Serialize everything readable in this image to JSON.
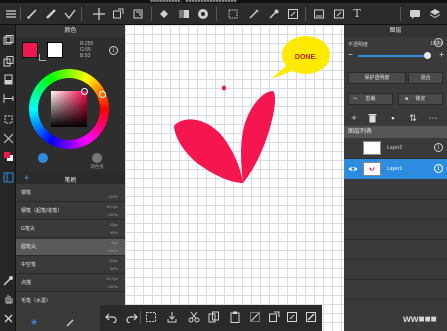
{
  "top_notice": "■■■■■■■■■■，■■■■■■■■■■■■■■■■■",
  "toolbar": {
    "icons": [
      "menu-icon",
      "brush-tool-icon",
      "eraser-icon",
      "checkmark-icon",
      "move-icon",
      "transform-icon",
      "lasso-select-icon",
      "fill-bucket-icon",
      "gradient-icon",
      "color-wheel-icon",
      "rectangle-select-icon",
      "magic-wand-icon",
      "eyedropper-icon",
      "copy-area-icon",
      "filter-icon",
      "select-pen-icon",
      "text-icon",
      "chat-icon",
      "layers-icon"
    ]
  },
  "leftbar": {
    "icons": [
      "layers-toggle-icon",
      "copy-icon",
      "eraser-side-icon",
      "ruler-icon",
      "snap-icon",
      "crop-icon",
      "color-swatch-icon",
      "panel-icon",
      "eyedropper-side-icon",
      "hand-icon",
      "clear-icon"
    ]
  },
  "color_panel": {
    "title": "颜色",
    "main_color": "#f0164f",
    "sub_color": "#ffffff",
    "rgb": {
      "r": "R:255",
      "g": "G:55",
      "b": "B:93"
    },
    "tabs": [
      {
        "label": "",
        "color": "#2d8be0"
      },
      {
        "label": "调色盘",
        "color": "#777777"
      }
    ]
  },
  "brush_panel": {
    "title": "笔刷",
    "items": [
      {
        "name": "钢笔",
        "v1": "",
        "v2": "100%"
      },
      {
        "name": "钢笔（起笔/收笔）",
        "v1": "10.0px",
        "v2": "100%"
      },
      {
        "name": "G笔尖",
        "v1": "15px",
        "v2": "98%"
      },
      {
        "name": "圆笔尖",
        "v1": "8px",
        "v2": "100%"
      },
      {
        "name": "中空笔",
        "v1": "42px",
        "v2": "96%"
      },
      {
        "name": "点描",
        "v1": "10.7px",
        "v2": "100%"
      },
      {
        "name": "毛笔（水墨）",
        "v1": "",
        "v2": ""
      }
    ],
    "selected_index": 3
  },
  "canvas": {
    "bubble_text": "DONE.",
    "bubble_color": "#ffea00",
    "bubble_text_color": "#b3281d",
    "heart_color": "#f5164f"
  },
  "bottom_bar": {
    "icons": [
      "undo-icon",
      "redo-icon",
      "select-all-icon",
      "import-icon",
      "cut-icon",
      "copy-icon",
      "paste-icon",
      "clear-selection-icon",
      "transform-icon",
      "edit-icon",
      "export-icon",
      "fill-icon"
    ]
  },
  "layer_panel": {
    "title": "图层",
    "opacity_label": "不透明度",
    "opacity_value": "100%",
    "opacity_fraction": 1.0,
    "protect_label": "保护透明度",
    "blend_label": "混合",
    "clip_label": "剪裁",
    "lock_label": "锁定",
    "list_title": "图层列表",
    "layers": [
      {
        "name": "Layer2",
        "selected": false,
        "visible": false
      },
      {
        "name": "Layer1",
        "selected": true,
        "visible": true
      }
    ]
  },
  "watermark": "ww■■■"
}
